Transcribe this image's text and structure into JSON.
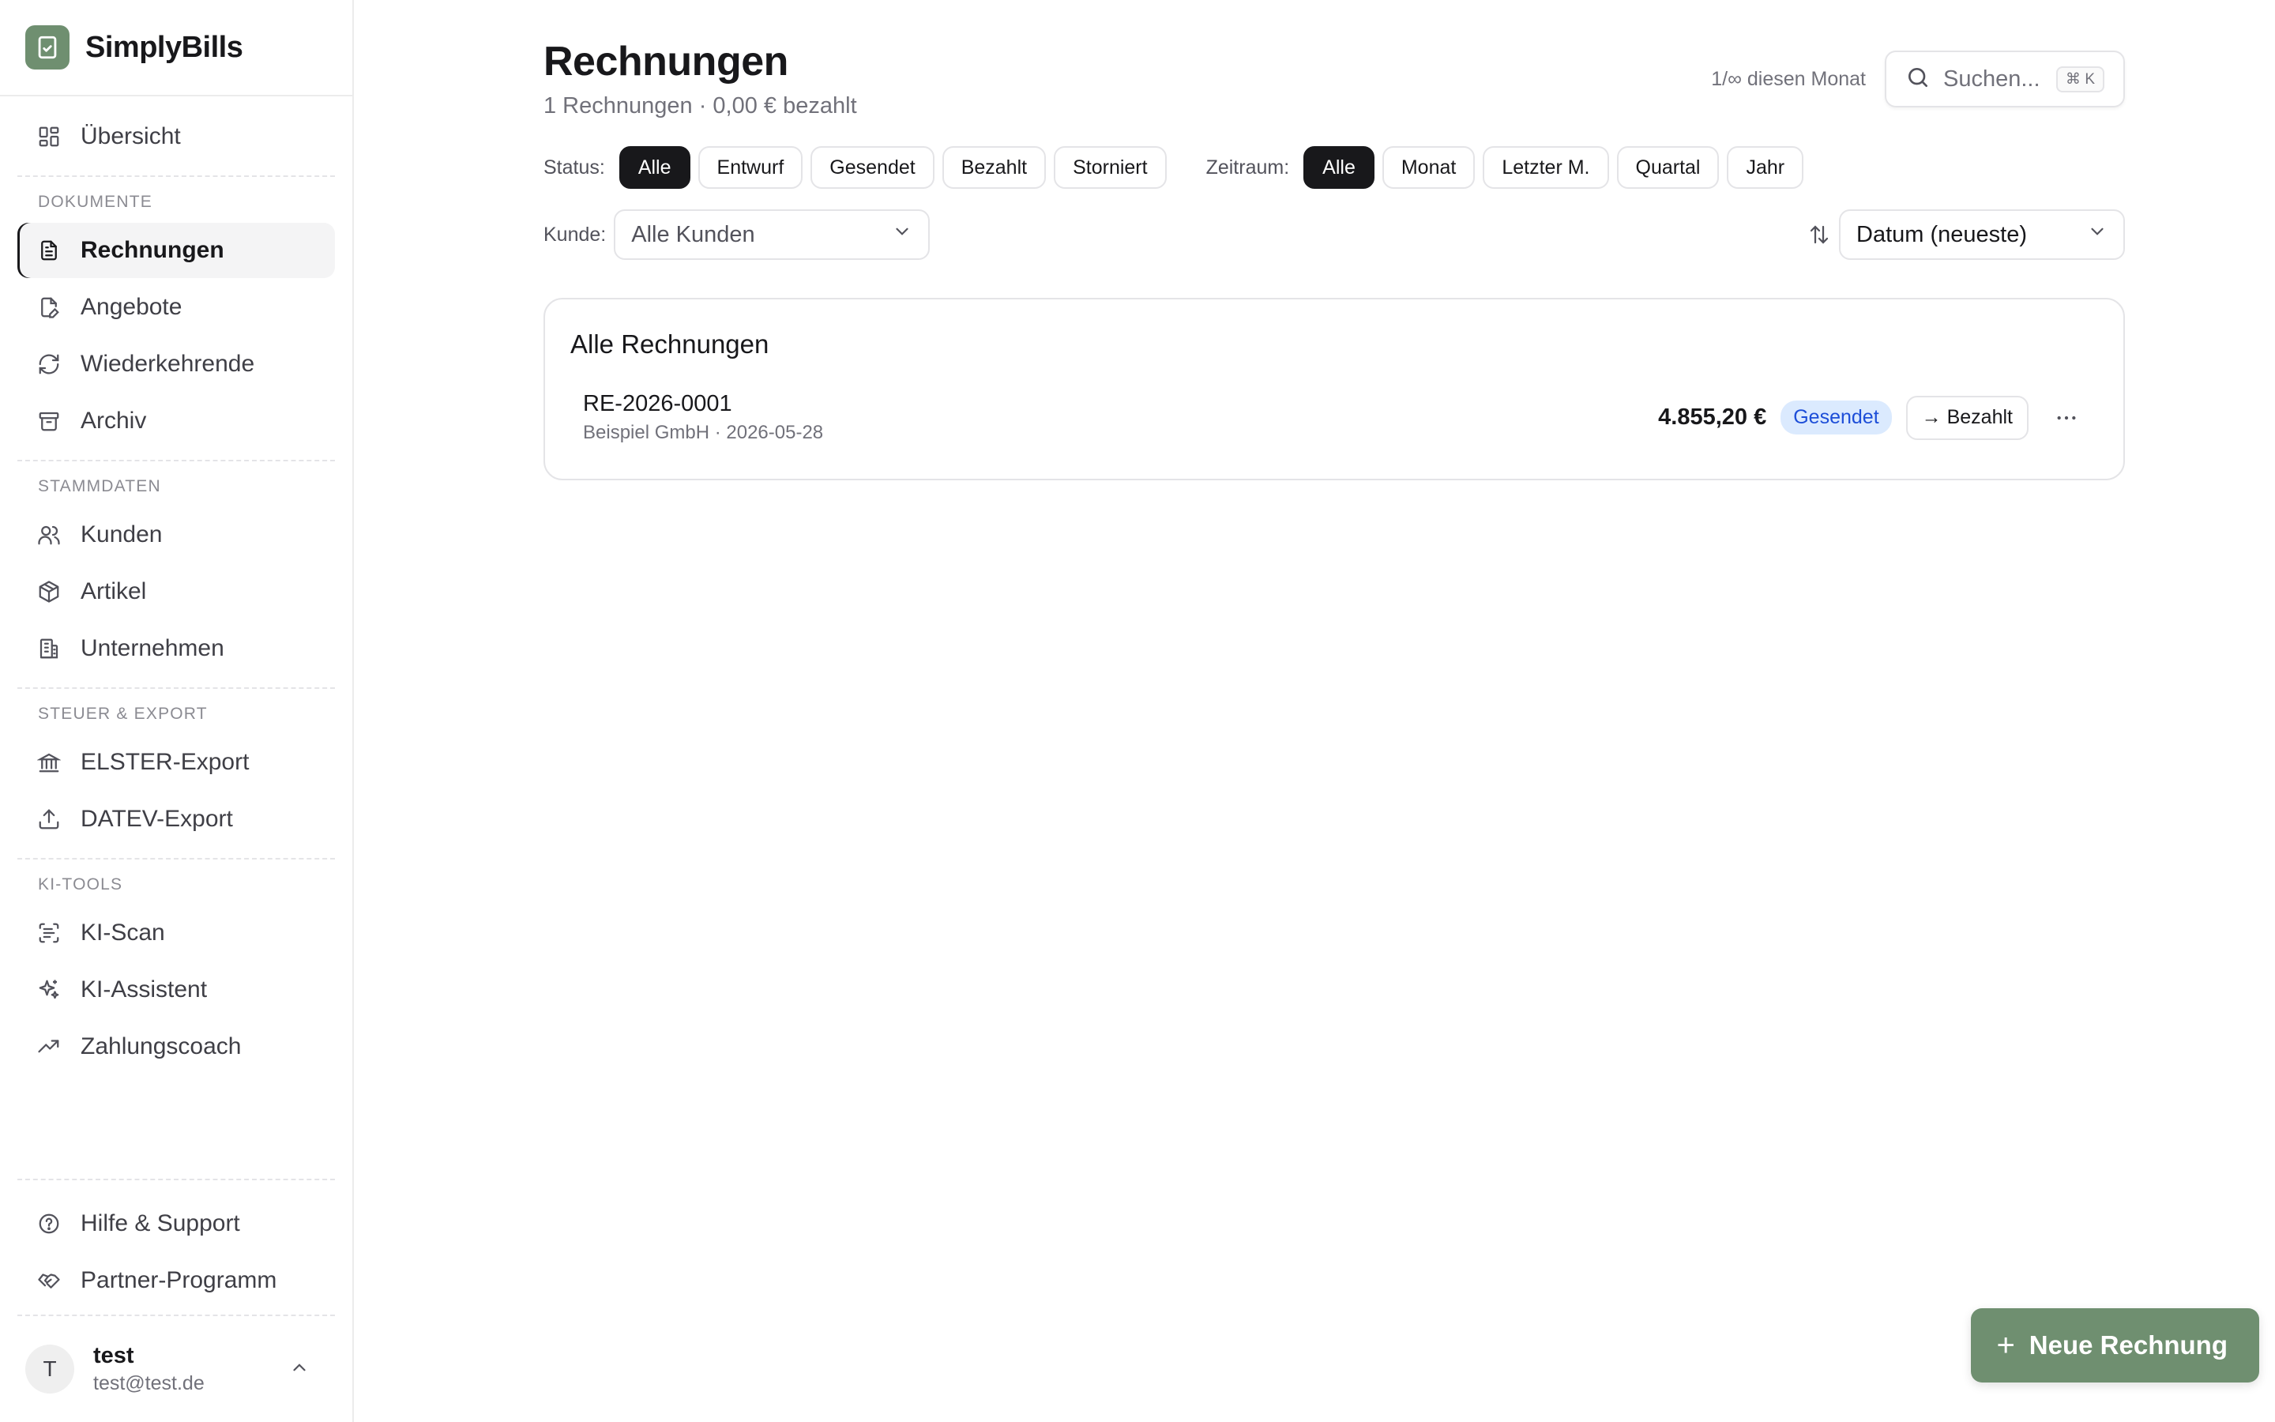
{
  "brand": {
    "name": "SimplyBills",
    "accent": "#6f8f70"
  },
  "sidebar": {
    "top": {
      "label": "Übersicht",
      "icon": "grid-icon"
    },
    "sections": [
      {
        "title": "DOKUMENTE",
        "items": [
          {
            "label": "Rechnungen",
            "icon": "invoice-icon",
            "active": true
          },
          {
            "label": "Angebote",
            "icon": "edit-document-icon"
          },
          {
            "label": "Wiederkehrende",
            "icon": "refresh-icon"
          },
          {
            "label": "Archiv",
            "icon": "archive-icon"
          }
        ]
      },
      {
        "title": "STAMMDATEN",
        "items": [
          {
            "label": "Kunden",
            "icon": "users-icon"
          },
          {
            "label": "Artikel",
            "icon": "package-icon"
          },
          {
            "label": "Unternehmen",
            "icon": "building-icon"
          }
        ]
      },
      {
        "title": "STEUER & EXPORT",
        "items": [
          {
            "label": "ELSTER-Export",
            "icon": "bank-icon"
          },
          {
            "label": "DATEV-Export",
            "icon": "upload-icon"
          }
        ]
      },
      {
        "title": "KI-TOOLS",
        "items": [
          {
            "label": "KI-Scan",
            "icon": "scan-icon"
          },
          {
            "label": "KI-Assistent",
            "icon": "sparkles-icon"
          },
          {
            "label": "Zahlungscoach",
            "icon": "trending-icon"
          }
        ]
      }
    ],
    "bottom": [
      {
        "label": "Hilfe & Support",
        "icon": "help-icon"
      },
      {
        "label": "Partner-Programm",
        "icon": "handshake-icon"
      }
    ],
    "user": {
      "initial": "T",
      "name": "test",
      "email": "test@test.de"
    }
  },
  "header": {
    "title": "Rechnungen",
    "subtitle": "1 Rechnungen · 0,00 € bezahlt",
    "quota": "1/∞ diesen Monat",
    "search_placeholder": "Suchen...",
    "search_shortcut": "⌘ K"
  },
  "filters": {
    "status_label": "Status:",
    "status": [
      "Alle",
      "Entwurf",
      "Gesendet",
      "Bezahlt",
      "Storniert"
    ],
    "status_selected": "Alle",
    "period_label": "Zeitraum:",
    "period": [
      "Alle",
      "Monat",
      "Letzter M.",
      "Quartal",
      "Jahr"
    ],
    "period_selected": "Alle",
    "customer_label": "Kunde:",
    "customer_value": "Alle Kunden",
    "sort_value": "Datum (neueste)"
  },
  "list": {
    "title": "Alle Rechnungen",
    "invoices": [
      {
        "number": "RE-2026-0001",
        "meta": "Beispiel GmbH · 2026-05-28",
        "amount": "4.855,20 €",
        "status": "Gesendet",
        "status_color": "#1d4ed8",
        "action": "→ Bezahlt"
      }
    ]
  },
  "fab": {
    "label": "Neue Rechnung"
  }
}
